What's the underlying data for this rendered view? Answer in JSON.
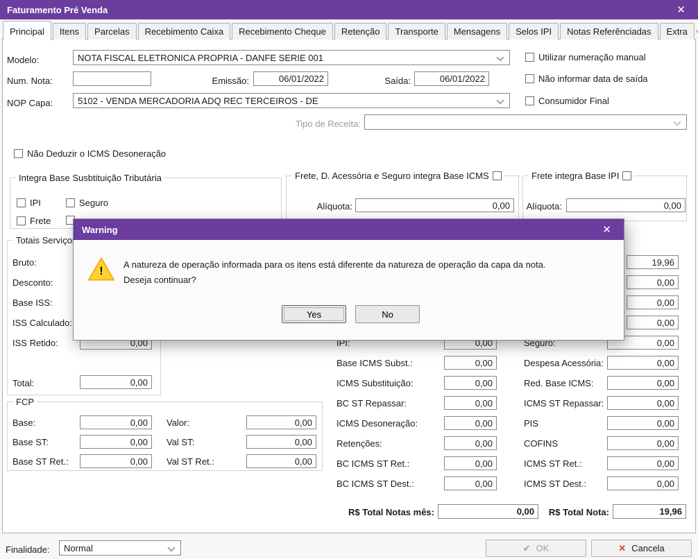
{
  "colors": {
    "titlebar": "#6a3d9e",
    "cancel_red": "#d9403a",
    "warning_yellow": "#ffd32e"
  },
  "icons": {
    "close": "✕",
    "ok_check": "✔",
    "cancel_x": "✕",
    "warning_mark": "!",
    "scroll_left": "‹",
    "scroll_right": "›"
  },
  "window": {
    "title": "Faturamento Pré Venda"
  },
  "tabs": [
    {
      "label": "Principal"
    },
    {
      "label": "Itens"
    },
    {
      "label": "Parcelas"
    },
    {
      "label": "Recebimento Caixa"
    },
    {
      "label": "Recebimento Cheque"
    },
    {
      "label": "Retenção"
    },
    {
      "label": "Transporte"
    },
    {
      "label": "Mensagens"
    },
    {
      "label": "Selos IPI"
    },
    {
      "label": "Notas Referênciadas"
    },
    {
      "label": "Extra"
    }
  ],
  "header": {
    "modelo_label": "Modelo:",
    "modelo_value": "NOTA FISCAL ELETRONICA PROPRIA - DANFE SERIE 001",
    "num_nota_label": "Num. Nota:",
    "num_nota_value": "",
    "emissao_label": "Emissão:",
    "emissao_value": "06/01/2022",
    "saida_label": "Saída:",
    "saida_value": "06/01/2022",
    "nop_label": "NOP Capa:",
    "nop_value": "5102 - VENDA MERCADORIA ADQ REC TERCEIROS - DE",
    "tipo_receita_label": "Tipo de Receita:",
    "tipo_receita_value": "",
    "chk_numeracao_manual": "Utilizar numeração manual",
    "chk_nao_informar_saida": "Não informar data de saída",
    "chk_consumidor_final": "Consumidor Final",
    "chk_nao_deduzir_icms": "Não Deduzir o ICMS Desoneração"
  },
  "integra": {
    "title": "Integra Base Susbtituição Tributária",
    "chk_ipi": "IPI",
    "chk_seguro": "Seguro",
    "chk_frete": "Frete"
  },
  "frete_icms": {
    "title": "Frete, D. Acessória e Seguro integra Base ICMS",
    "aliquota_label": "Alíquota:",
    "aliquota_value": "0,00"
  },
  "frete_ipi": {
    "title": "Frete integra Base IPI",
    "aliquota_label": "Alíquota:",
    "aliquota_value": "0,00"
  },
  "totais_servicos": {
    "title": "Totais Serviços",
    "bruto_label": "Bruto:",
    "desconto_label": "Desconto:",
    "base_iss_label": "Base ISS:",
    "iss_calculado_label": "ISS Calculado:",
    "iss_retido_label": "ISS Retido:",
    "iss_retido_value": "0,00",
    "total_label": "Total:",
    "total_value": "0,00"
  },
  "totais_produtos": {
    "mid_rows": [
      {
        "label": "IPI:",
        "value": "0,00"
      },
      {
        "label": "Base ICMS Subst.:",
        "value": "0,00"
      },
      {
        "label": "ICMS Substituição:",
        "value": "0,00"
      },
      {
        "label": "BC ST Repassar:",
        "value": "0,00"
      },
      {
        "label": "ICMS Desoneração:",
        "value": "0,00"
      },
      {
        "label": "Retenções:",
        "value": "0,00"
      },
      {
        "label": "BC ICMS ST Ret.:",
        "value": "0,00"
      },
      {
        "label": "BC ICMS ST Dest.:",
        "value": "0,00"
      }
    ],
    "right_top_values": [
      "19,96",
      "0,00",
      "0,00",
      "0,00"
    ],
    "right_rows": [
      {
        "label": "Seguro:",
        "value": "0,00"
      },
      {
        "label": "Despesa Acessória:",
        "value": "0,00"
      },
      {
        "label": "Red. Base ICMS:",
        "value": "0,00"
      },
      {
        "label": "ICMS ST Repassar:",
        "value": "0,00"
      },
      {
        "label": "PIS",
        "value": "0,00"
      },
      {
        "label": "COFINS",
        "value": "0,00"
      },
      {
        "label": "ICMS ST Ret.:",
        "value": "0,00"
      },
      {
        "label": "ICMS ST Dest.:",
        "value": "0,00"
      }
    ]
  },
  "fcp": {
    "title": "FCP",
    "rows": [
      {
        "label1": "Base:",
        "value1": "0,00",
        "label2": "Valor:",
        "value2": "0,00"
      },
      {
        "label1": "Base ST:",
        "value1": "0,00",
        "label2": "Val ST:",
        "value2": "0,00"
      },
      {
        "label1": "Base ST Ret.:",
        "value1": "0,00",
        "label2": "Val ST Ret.:",
        "value2": "0,00"
      }
    ]
  },
  "totals_bar": {
    "mes_label": "R$ Total Notas mês:",
    "mes_value": "0,00",
    "nota_label": "R$ Total Nota:",
    "nota_value": "19,96"
  },
  "footer": {
    "finalidade_label": "Finalidade:",
    "finalidade_value": "Normal",
    "ok_label": "OK",
    "cancela_label": "Cancela"
  },
  "warning_dialog": {
    "title": "Warning",
    "message": "A natureza de operação informada para os itens está diferente da natureza de operação da capa da nota.",
    "question": "Deseja continuar?",
    "yes_label": "Yes",
    "no_label": "No"
  }
}
